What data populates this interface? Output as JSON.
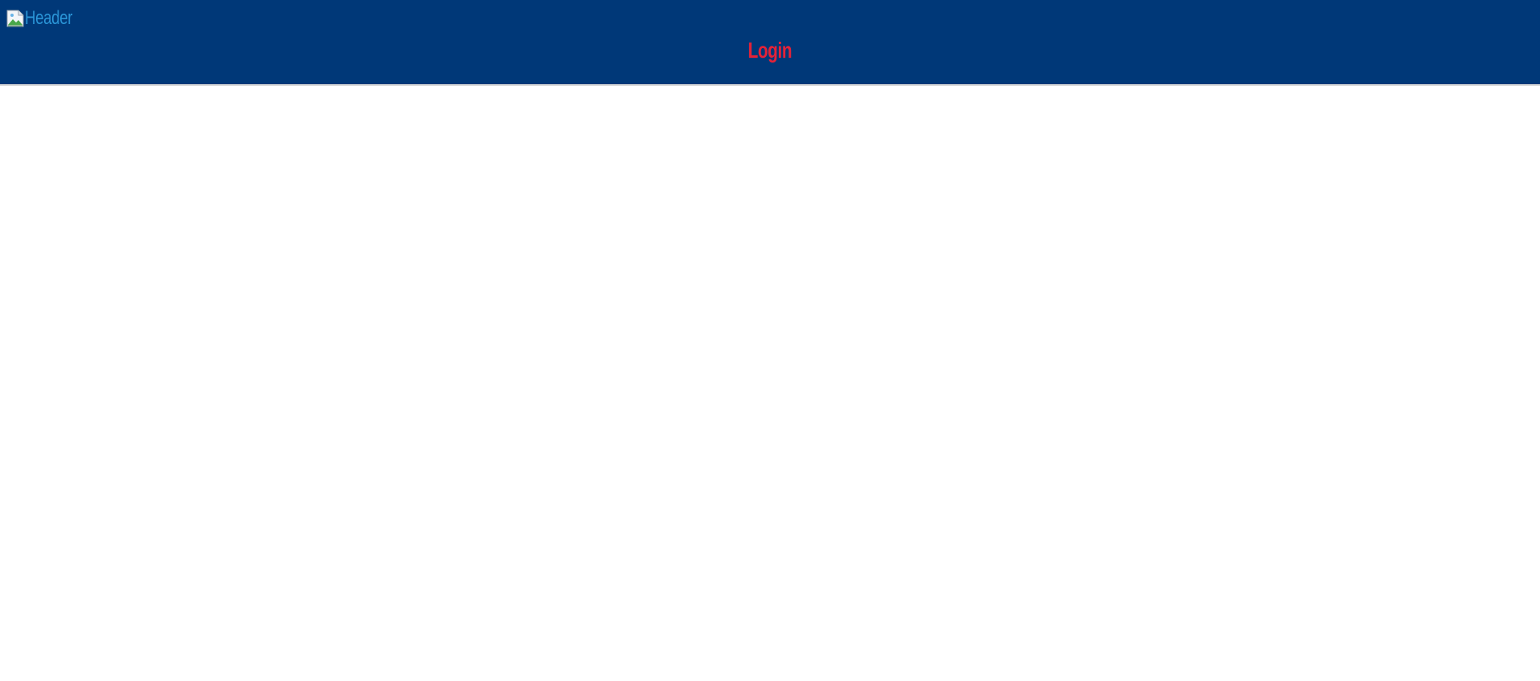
{
  "header": {
    "image_alt": "Header",
    "login_label": "Login"
  },
  "colors": {
    "header_background": "#003878",
    "alt_text": "#2a95d7",
    "login_text": "#e52238",
    "page_background": "#ffffff"
  },
  "icons": {
    "header_image": "broken-image-icon"
  }
}
